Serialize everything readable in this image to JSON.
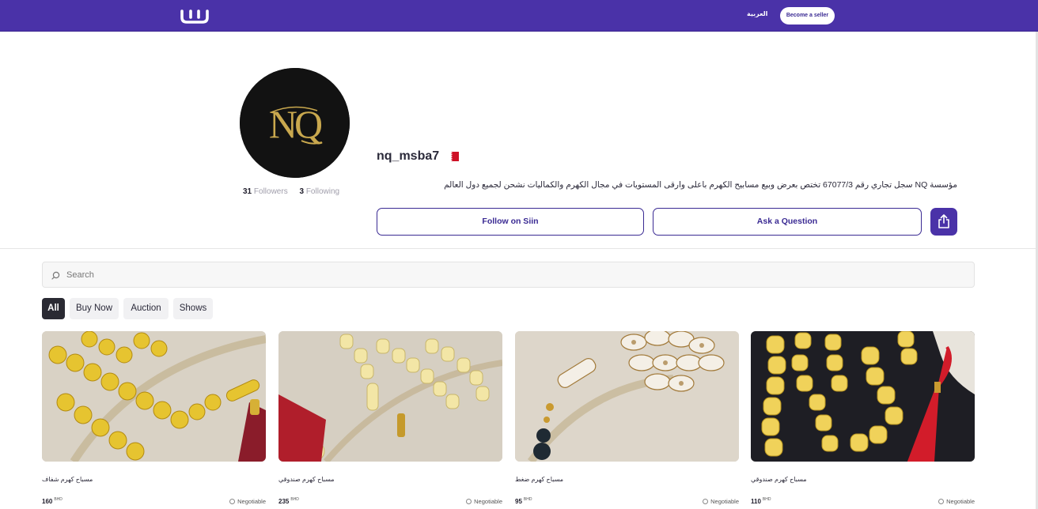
{
  "nav": {
    "logo_alt": "Siin",
    "language_link": "العربية",
    "seller_button": "Become a seller"
  },
  "profile": {
    "username": "nq_msba7",
    "country_flag": "bahrain-flag",
    "followers_count": "31",
    "followers_label": "Followers",
    "following_count": "3",
    "following_label": "Following",
    "bio": "مؤسسة NQ سجل تجاري رقم 67077/3 تختص بعرض وبيع مسابيح الكهرم باعلى وارقى المستويات في مجال الكهرم والكماليات نشحن لجميع دول العالم",
    "follow_button": "Follow on Siin",
    "ask_button": "Ask a Question"
  },
  "search": {
    "placeholder": "Search"
  },
  "filters": [
    "All",
    "Buy Now",
    "Auction",
    "Shows"
  ],
  "active_filter": "All",
  "products": [
    {
      "title": "مسباح كهرم شفاف",
      "price": "160",
      "currency": "BHD",
      "badge": "Negotiable"
    },
    {
      "title": "مسباح كهرم صندوقي",
      "price": "235",
      "currency": "BHD",
      "badge": "Negotiable"
    },
    {
      "title": "مسباح كهرم ضغط",
      "price": "95",
      "currency": "BHD",
      "badge": "Negotiable"
    },
    {
      "title": "مسباح كهرم صندوقي",
      "price": "110",
      "currency": "BHD",
      "badge": "Negotiable"
    }
  ],
  "colors": {
    "brand": "#4a32a8",
    "accent_text": "#3a2a93",
    "dark": "#2a2a33"
  }
}
